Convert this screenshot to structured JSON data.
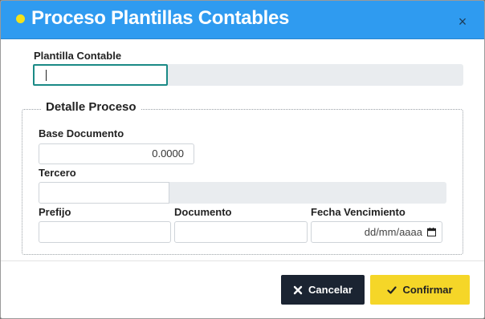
{
  "dialog": {
    "title": "Proceso Plantillas Contables",
    "close_label": "×"
  },
  "plantilla": {
    "label": "Plantilla Contable",
    "value": ""
  },
  "detalle": {
    "legend": "Detalle Proceso",
    "base_documento": {
      "label": "Base Documento",
      "value": "0.0000"
    },
    "tercero": {
      "label": "Tercero",
      "value": ""
    },
    "prefijo": {
      "label": "Prefijo",
      "value": ""
    },
    "documento": {
      "label": "Documento",
      "value": ""
    },
    "fecha_vencimiento": {
      "label": "Fecha Vencimiento",
      "placeholder": "dd/mm/aaaa"
    }
  },
  "buttons": {
    "cancel_label": "Cancelar",
    "confirm_label": "Confirmar"
  },
  "colors": {
    "header": "#2f9bf0",
    "title_dot": "#f3e21a",
    "cancel_bg": "#1b2432",
    "confirm_bg": "#f5d628",
    "focus_border": "#1a8a86"
  }
}
